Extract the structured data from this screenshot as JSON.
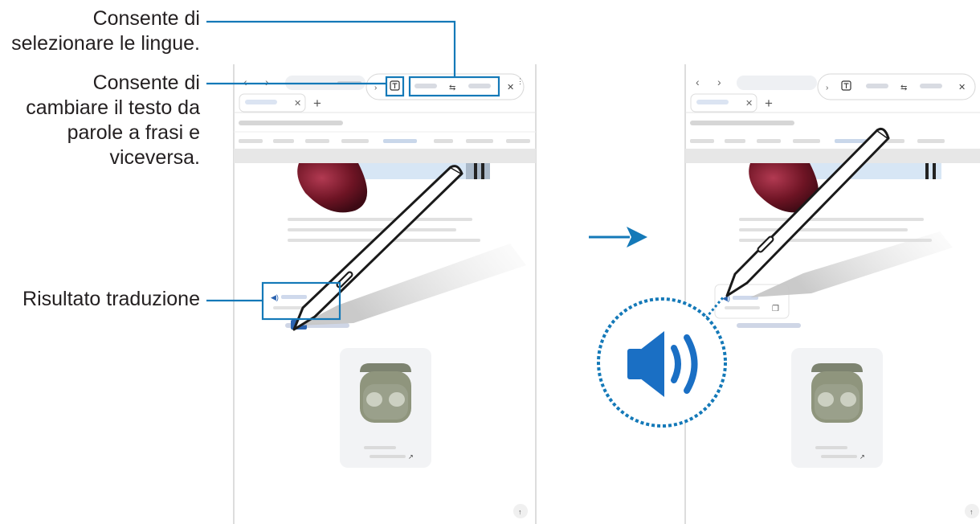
{
  "callouts": {
    "languages": [
      "Consente di",
      "selezionare le lingue."
    ],
    "text_mode": [
      "Consente di",
      "cambiare il testo da",
      "parole a frasi e",
      "viceversa."
    ],
    "result": "Risultato traduzione"
  },
  "colors": {
    "accent": "#1479b8",
    "callout_text": "#231f20",
    "pen": "#1a1a1a",
    "earbud_case": "#8f957d"
  },
  "icons": [
    "speaker-icon",
    "swap-languages-icon",
    "text-mode-icon",
    "close-icon",
    "copy-icon",
    "scroll-up-icon",
    "arrow-right-icon"
  ]
}
